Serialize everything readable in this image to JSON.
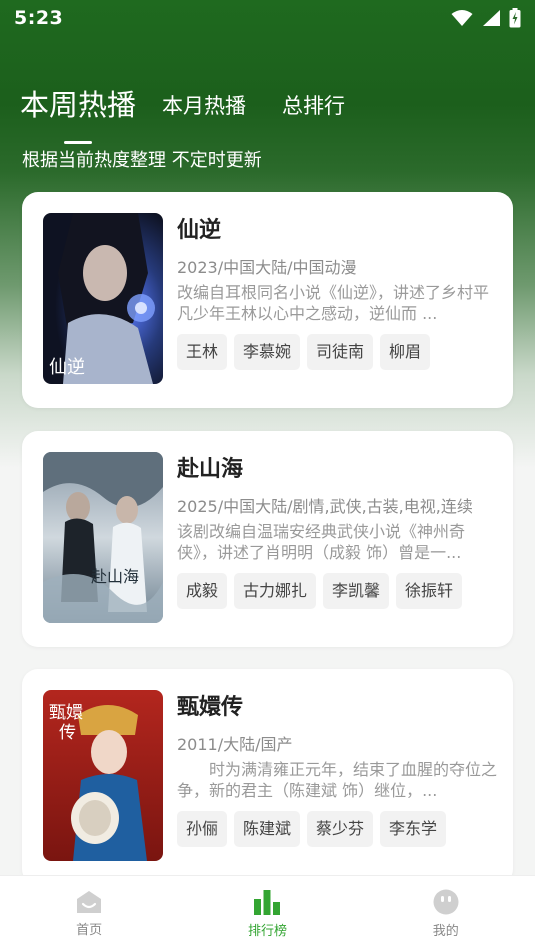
{
  "status_bar": {
    "time": "5:23"
  },
  "tabs": [
    {
      "label": "本周热播",
      "active": true
    },
    {
      "label": "本月热播",
      "active": false
    },
    {
      "label": "总排行",
      "active": false
    }
  ],
  "subtitle": "根据当前热度整理 不定时更新",
  "cards": [
    {
      "title": "仙逆",
      "meta": "2023/中国大陆/中国动漫",
      "desc": "改编自耳根同名小说《仙逆》，讲述了乡村平凡少年王林以心中之感动，逆仙而 ...",
      "tags": [
        "王林",
        "李慕婉",
        "司徒南",
        "柳眉"
      ]
    },
    {
      "title": "赴山海",
      "meta": "2025/中国大陆/剧情,武侠,古装,电视,连续",
      "desc": "该剧改编自温瑞安经典武侠小说《神州奇侠》，讲述了肖明明（成毅 饰）曾是一...",
      "tags": [
        "成毅",
        "古力娜扎",
        "李凯馨",
        "徐振轩"
      ]
    },
    {
      "title": "甄嬛传",
      "meta": "2011/大陆/国产",
      "desc": "　　时为满清雍正元年，结束了血腥的夺位之争，新的君主（陈建斌 饰）继位，...",
      "tags": [
        "孙俪",
        "陈建斌",
        "蔡少芬",
        "李东学"
      ]
    }
  ],
  "bottom_nav": [
    {
      "label": "首页",
      "icon": "home-icon",
      "active": false
    },
    {
      "label": "排行榜",
      "icon": "ranking-icon",
      "active": true
    },
    {
      "label": "我的",
      "icon": "profile-icon",
      "active": false
    }
  ],
  "colors": {
    "accent": "#33a532",
    "header_green": "#1f6a1f"
  }
}
